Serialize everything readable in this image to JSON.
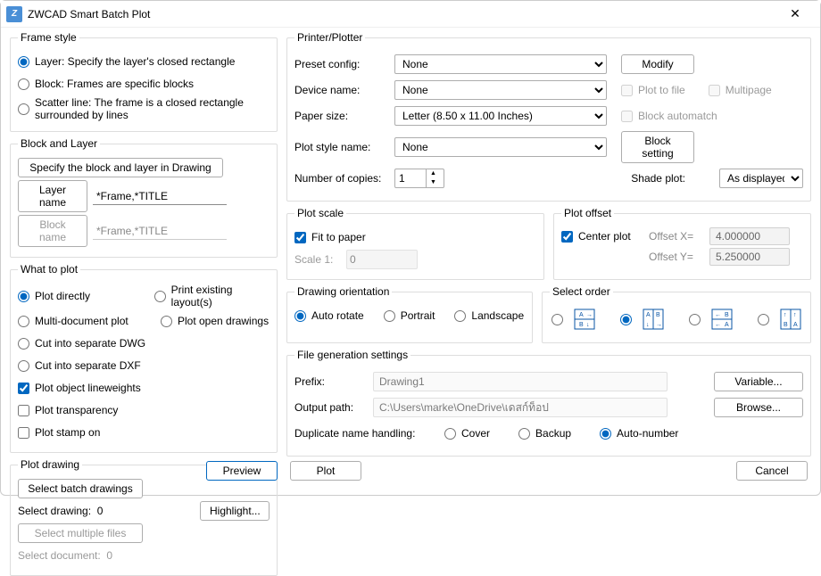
{
  "window": {
    "title": "ZWCAD Smart Batch Plot"
  },
  "frameStyle": {
    "legend": "Frame style",
    "options": {
      "layer": "Layer: Specify the layer's closed rectangle",
      "block": "Block: Frames are specific blocks",
      "scatter": "Scatter line: The frame is a closed rectangle surrounded by lines"
    }
  },
  "blockLayer": {
    "legend": "Block and Layer",
    "specifyBtn": "Specify the block and layer in Drawing",
    "layerNameBtn": "Layer name",
    "layerNameVal": "*Frame,*TITLE",
    "blockNameBtn": "Block name",
    "blockNameVal": "*Frame,*TITLE"
  },
  "whatToPlot": {
    "legend": "What to plot",
    "plotDirectly": "Plot directly",
    "printExisting": "Print existing layout(s)",
    "multiDoc": "Multi-document plot",
    "plotOpen": "Plot open drawings",
    "cutDwg": "Cut into separate DWG",
    "cutDxf": "Cut into separate DXF",
    "lineweights": "Plot object lineweights",
    "transparency": "Plot transparency",
    "stamp": "Plot stamp on"
  },
  "plotDrawing": {
    "legend": "Plot drawing",
    "selectBatch": "Select batch drawings",
    "selectDrawingLbl": "Select drawing:",
    "selectDrawingCount": "0",
    "highlightBtn": "Highlight...",
    "selectMultiple": "Select multiple files",
    "selectDocumentLbl": "Select document:",
    "selectDocumentCount": "0"
  },
  "printer": {
    "legend": "Printer/Plotter",
    "presetLbl": "Preset config:",
    "presetVal": "None",
    "modifyBtn": "Modify",
    "deviceLbl": "Device name:",
    "deviceVal": "None",
    "plotToFile": "Plot to file",
    "multipage": "Multipage",
    "paperLbl": "Paper size:",
    "paperVal": "Letter (8.50 x 11.00 Inches)",
    "blockAutomatch": "Block automatch",
    "styleLbl": "Plot style name:",
    "styleVal": "None",
    "blockSettingBtn": "Block setting",
    "copiesLbl": "Number of copies:",
    "copiesVal": "1",
    "shadeLbl": "Shade plot:",
    "shadeVal": "As displayed"
  },
  "plotScale": {
    "legend": "Plot scale",
    "fitToPaper": "Fit to paper",
    "scaleLbl": "Scale 1:",
    "scaleVal": "0"
  },
  "plotOffset": {
    "legend": "Plot offset",
    "centerPlot": "Center plot",
    "offsetXLbl": "Offset X=",
    "offsetXVal": "4.000000",
    "offsetYLbl": "Offset Y=",
    "offsetYVal": "5.250000"
  },
  "orientation": {
    "legend": "Drawing orientation",
    "auto": "Auto rotate",
    "portrait": "Portrait",
    "landscape": "Landscape"
  },
  "selectOrder": {
    "legend": "Select order"
  },
  "fileGen": {
    "legend": "File generation settings",
    "prefixLbl": "Prefix:",
    "prefixVal": "Drawing1",
    "variableBtn": "Variable...",
    "outputLbl": "Output path:",
    "outputVal": "C:\\Users\\marke\\OneDrive\\เดสก์ท็อป",
    "browseBtn": "Browse...",
    "dupLbl": "Duplicate name handling:",
    "cover": "Cover",
    "backup": "Backup",
    "autonum": "Auto-number"
  },
  "footer": {
    "preview": "Preview",
    "plot": "Plot",
    "cancel": "Cancel"
  }
}
